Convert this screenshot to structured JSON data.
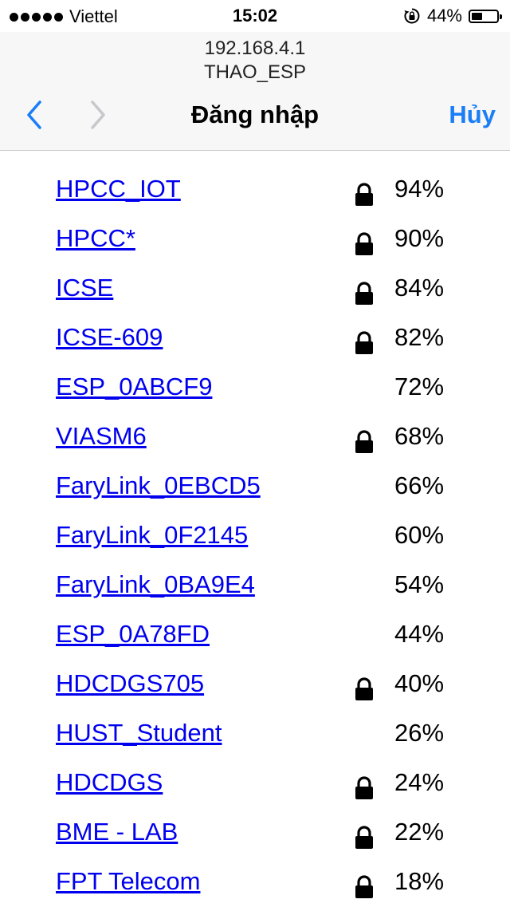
{
  "status_bar": {
    "carrier": "Viettel",
    "time": "15:02",
    "battery_text": "44%",
    "battery_level": 0.44
  },
  "header": {
    "url": "192.168.4.1",
    "ssid": "THAO_ESP",
    "title": "Đăng nhập",
    "cancel_label": "Hủy"
  },
  "networks": [
    {
      "ssid": "HPCC_IOT",
      "locked": true,
      "signal": "94%"
    },
    {
      "ssid": "HPCC*",
      "locked": true,
      "signal": "90%"
    },
    {
      "ssid": "ICSE",
      "locked": true,
      "signal": "84%"
    },
    {
      "ssid": "ICSE-609",
      "locked": true,
      "signal": "82%"
    },
    {
      "ssid": "ESP_0ABCF9",
      "locked": false,
      "signal": "72%"
    },
    {
      "ssid": "VIASM6",
      "locked": true,
      "signal": "68%"
    },
    {
      "ssid": "FaryLink_0EBCD5",
      "locked": false,
      "signal": "66%"
    },
    {
      "ssid": "FaryLink_0F2145",
      "locked": false,
      "signal": "60%"
    },
    {
      "ssid": "FaryLink_0BA9E4",
      "locked": false,
      "signal": "54%"
    },
    {
      "ssid": "ESP_0A78FD",
      "locked": false,
      "signal": "44%"
    },
    {
      "ssid": "HDCDGS705",
      "locked": true,
      "signal": "40%"
    },
    {
      "ssid": "HUST_Student",
      "locked": false,
      "signal": "26%"
    },
    {
      "ssid": "HDCDGS",
      "locked": true,
      "signal": "24%"
    },
    {
      "ssid": "BME - LAB",
      "locked": true,
      "signal": "22%"
    },
    {
      "ssid": "FPT Telecom",
      "locked": true,
      "signal": "18%"
    }
  ],
  "colors": {
    "accent": "#1b7ef7",
    "link": "#0000ee"
  }
}
